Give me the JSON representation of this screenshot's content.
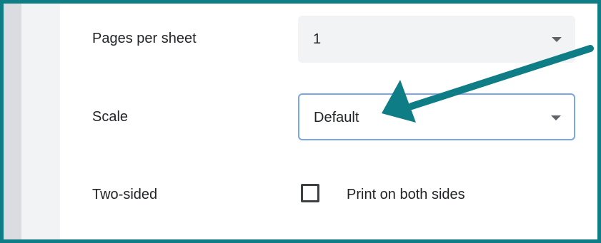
{
  "print_settings": {
    "pages_per_sheet": {
      "label": "Pages per sheet",
      "value": "1"
    },
    "scale": {
      "label": "Scale",
      "value": "Default"
    },
    "two_sided": {
      "label": "Two-sided",
      "checkbox_label": "Print on both sides",
      "checked": false
    }
  },
  "annotation": {
    "type": "arrow",
    "color": "#0f7d86",
    "points_to": "scale-select"
  }
}
